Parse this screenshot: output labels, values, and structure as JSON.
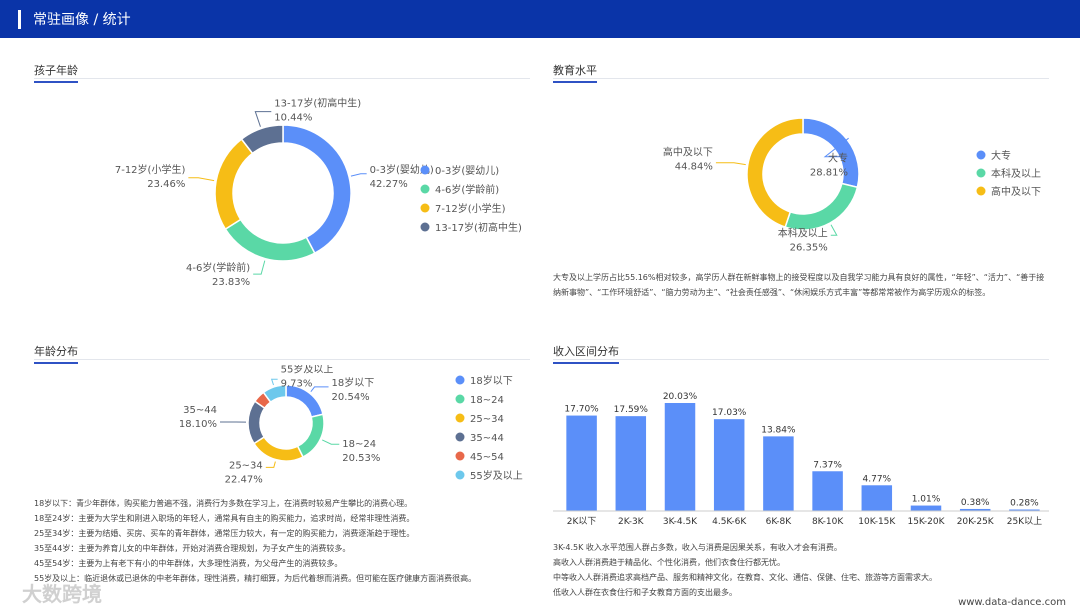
{
  "header": {
    "title": "常驻画像 / 统计"
  },
  "panels": {
    "child_age": {
      "title": "孩子年龄"
    },
    "education": {
      "title": "教育水平",
      "note": "大专及以上学历占比55.16%相对较多，高学历人群在新鲜事物上的接受程度以及自我学习能力具有良好的属性，“年轻”、“活力”、“善于接纳新事物”、“工作环境舒适”、“脑力劳动为主”、“社会责任感强”、“休闲娱乐方式丰富”等都常常被作为高学历观众的标签。"
    },
    "age_dist": {
      "title": "年龄分布",
      "notes": [
        "18岁以下：青少年群体，购买能力普遍不强，消费行为多数在学习上，在消费时较易产生攀比的消费心理。",
        "18至24岁：主要为大学生和刚进入职场的年轻人，通常具有自主的购买能力，追求时尚，经常非理性消费。",
        "25至34岁：主要为结婚、买房、买车的青年群体，通常压力较大，有一定的购买能力，消费逐渐趋于理性。",
        "35至44岁：主要为养育儿女的中年群体，开始对消费合理规划，为子女产生的消费较多。",
        "45至54岁：主要为上有老下有小的中年群体，大多理性消费，为父母产生的消费较多。",
        "55岁及以上：临近退休或已退休的中老年群体，理性消费，精打细算，为后代着想而消费。但可能在医疗健康方面消费很高。"
      ]
    },
    "income": {
      "title": "收入区间分布",
      "notes": [
        "3K-4.5K 收入水平范围人群占多数，收入与消费是因果关系，有收入才会有消费。",
        "高收入人群消费趋于精品化、个性化消费，他们衣食住行都无忧。",
        "中等收入人群消费追求高档产品、服务和精神文化，在教育、文化、通信、保健、住宅、旅游等方面需求大。",
        "低收入人群在衣食住行和子女教育方面的支出最多。"
      ]
    }
  },
  "chart_data": [
    {
      "type": "pie",
      "title": "孩子年龄",
      "categories": [
        "0-3岁(婴幼儿)",
        "4-6岁(学龄前)",
        "7-12岁(小学生)",
        "13-17岁(初高中生)"
      ],
      "values": [
        42.27,
        23.83,
        23.46,
        10.44
      ],
      "colors": [
        "#5b8ff9",
        "#5ad8a6",
        "#f6bd16",
        "#5d7092"
      ],
      "legend": "right"
    },
    {
      "type": "pie",
      "title": "教育水平",
      "categories": [
        "大专",
        "本科及以上",
        "高中及以下"
      ],
      "values": [
        28.81,
        26.35,
        44.84
      ],
      "colors": [
        "#5b8ff9",
        "#5ad8a6",
        "#f6bd16"
      ],
      "legend": "right"
    },
    {
      "type": "pie",
      "title": "年龄分布",
      "categories": [
        "18岁以下",
        "18~24",
        "25~34",
        "35~44",
        "45~54",
        "55岁及以上"
      ],
      "values": [
        20.54,
        20.53,
        22.47,
        18.1,
        5.0,
        9.73
      ],
      "colors": [
        "#5b8ff9",
        "#5ad8a6",
        "#f6bd16",
        "#5d7092",
        "#e8684a",
        "#6dc8ec"
      ],
      "legend": "right"
    },
    {
      "type": "bar",
      "title": "收入区间分布",
      "categories": [
        "2K以下",
        "2K-3K",
        "3K-4.5K",
        "4.5K-6K",
        "6K-8K",
        "8K-10K",
        "10K-15K",
        "15K-20K",
        "20K-25K",
        "25K以上"
      ],
      "values": [
        17.7,
        17.59,
        20.03,
        17.03,
        13.84,
        7.37,
        4.77,
        1.01,
        0.38,
        0.28
      ],
      "labels": [
        "17.70%",
        "17.59%",
        "20.03%",
        "17.03%",
        "13.84%",
        "7.37%",
        "4.77%",
        "1.01%",
        "0.38%",
        "0.28%"
      ],
      "color": "#5b8ff9",
      "ylim": [
        0,
        20.03
      ]
    }
  ],
  "watermark": {
    "logo": "大数跨境",
    "url": "www.data-dance.com"
  }
}
